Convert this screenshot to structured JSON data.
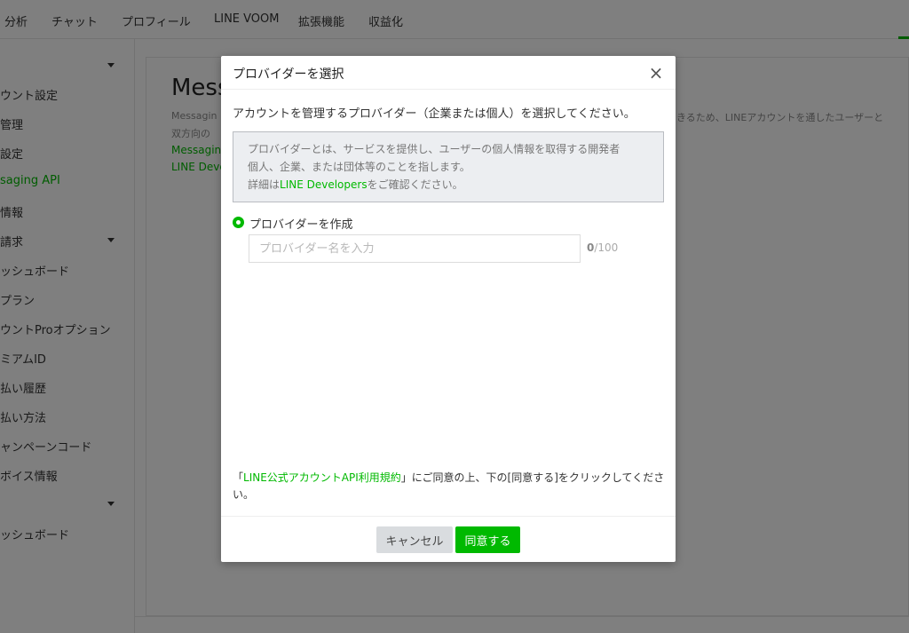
{
  "topnav": {
    "items": [
      "分析",
      "チャット",
      "プロフィール",
      "LINE VOOM",
      "拡張機能",
      "収益化"
    ]
  },
  "sidebar": {
    "items": [
      "ウント設定",
      "管理",
      "設定",
      "saging API",
      "情報",
      "請求",
      "ッシュボード",
      "プラン",
      "ウントProオプション",
      "ミアムID",
      "払い履歴",
      "払い方法",
      "ャンペーンコード",
      "ボイス情報",
      "ッシュボード"
    ]
  },
  "main": {
    "title": "Mess",
    "desc_line1": "Messagin",
    "desc_line2": "双方向の",
    "desc_right": "きるため、LINEアカウントを通したユーザーと",
    "link1": "Messagin",
    "link2": "LINE Develo"
  },
  "modal": {
    "title": "プロバイダーを選択",
    "close_icon": "×",
    "lead": "アカウントを管理するプロバイダー（企業または個人）を選択してください。",
    "info": {
      "line1": "プロバイダーとは、サービスを提供し、ユーザーの個人情報を取得する開発者",
      "line2": "個人、企業、または団体等のことを指します。",
      "line3_prefix": "詳細は",
      "line3_link": "LINE Developers",
      "line3_suffix": "をご確認ください。"
    },
    "radio_label": "プロバイダーを作成",
    "input": {
      "placeholder": "プロバイダー名を入力",
      "value": ""
    },
    "counter": {
      "current": "0",
      "max": "/100"
    },
    "terms": {
      "open_quote": "「",
      "link": "LINE公式アカウントAPI利用規約",
      "rest": "」にご同意の上、下の[同意する]をクリックしてください。"
    },
    "buttons": {
      "cancel": "キャンセル",
      "agree": "同意する"
    }
  },
  "colors": {
    "accent": "#00b900",
    "overlay": "rgba(0,0,0,0.5)"
  }
}
